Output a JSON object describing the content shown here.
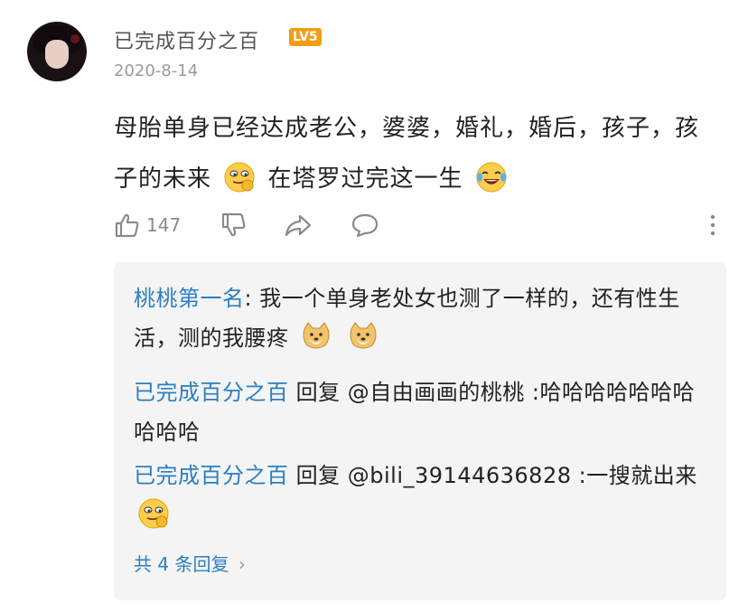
{
  "comment": {
    "username": "已完成百分之百",
    "level_badge": "LV5",
    "date": "2020-8-14",
    "content_part1": "母胎单身已经达成老公，婆婆，婚礼，婚后，孩子，孩子的未来",
    "emoji_1": "smirk-emoji",
    "content_part2": "在塔罗过完这一生",
    "emoji_2": "laugh-cry-emoji",
    "likes": "147"
  },
  "actions": {
    "like_icon": "thumbs-up-icon",
    "dislike_icon": "thumbs-down-icon",
    "share_icon": "share-icon",
    "comment_icon": "comment-icon",
    "more_icon": "more-vertical-icon"
  },
  "replies": [
    {
      "author": "桃桃第一名",
      "sep": ":",
      "text": "我一个单身老处女也测了一样的，还有性生活，测的我腰疼",
      "emojis": [
        "doge-emoji",
        "doge-emoji"
      ]
    },
    {
      "author": "已完成百分之百",
      "reply_word": "回复",
      "mention": "@自由画画的桃桃",
      "text": ":哈哈哈哈哈哈哈哈哈哈"
    },
    {
      "author": "已完成百分之百",
      "reply_word": "回复",
      "mention": "@bili_39144636828",
      "text": ":一搜就出来",
      "emojis": [
        "smirk-emoji"
      ]
    }
  ],
  "more_replies": "共 4 条回复",
  "colors": {
    "link": "#2a7fc2",
    "badge": "#f39c12",
    "reply_bg": "#f4f4f4"
  }
}
